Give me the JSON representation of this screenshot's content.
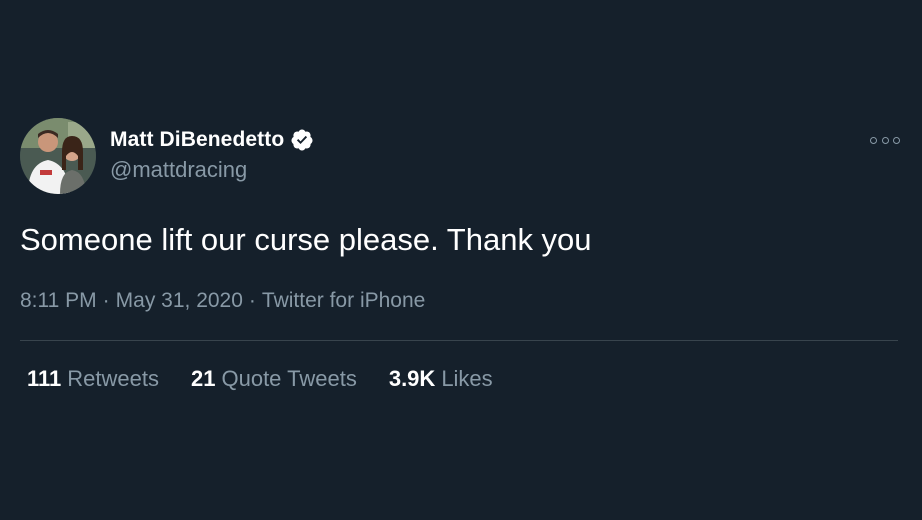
{
  "user": {
    "display_name": "Matt DiBenedetto",
    "handle": "@mattdracing",
    "verified": true,
    "avatar_icon": "profile-photo",
    "verified_icon": "verified-badge-icon"
  },
  "tweet": {
    "text": "Someone lift our curse please. Thank you",
    "time": "8:11 PM",
    "date": "May 31, 2020",
    "source": "Twitter for iPhone",
    "separator": "·"
  },
  "stats": {
    "retweets_count": "111",
    "retweets_label": "Retweets",
    "quotes_count": "21",
    "quotes_label": "Quote Tweets",
    "likes_count": "3.9K",
    "likes_label": "Likes"
  },
  "colors": {
    "background": "#15202b",
    "primary_text": "#ffffff",
    "secondary_text": "#8899a6",
    "divider": "#38444d"
  }
}
